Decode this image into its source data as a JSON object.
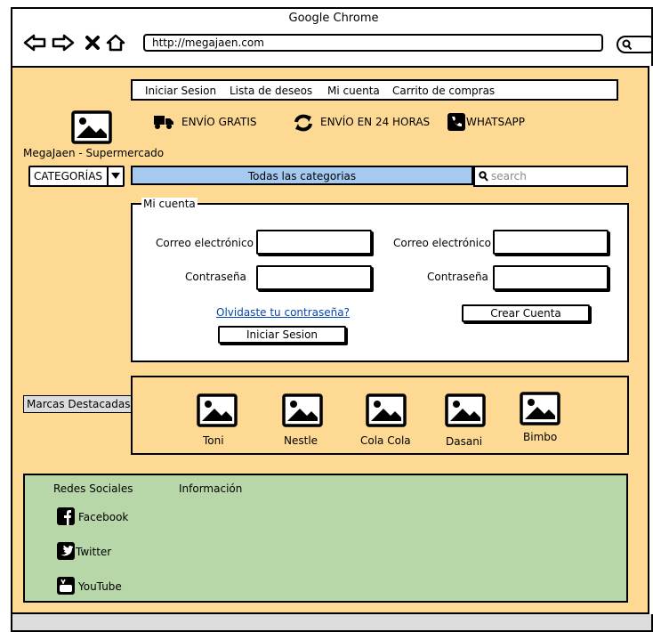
{
  "window": {
    "title": "Google Chrome",
    "url": "http://megajaen.com"
  },
  "nav": {
    "items": [
      "Iniciar Sesion",
      "Lista de deseos",
      "Mi cuenta",
      "Carrito de compras"
    ]
  },
  "features": {
    "free_shipping": "ENVÍO GRATIS",
    "fast_delivery": "ENVÍO EN 24 HORAS",
    "whatsapp": "WHATSAPP"
  },
  "brand": {
    "name": "MegaJaen - Supermercado"
  },
  "search": {
    "category_label": "CATEGORÍAS",
    "all_categories": "Todas las categorias",
    "placeholder": "search"
  },
  "account": {
    "legend": "Mi cuenta",
    "login_email_label": "Correo electrónico",
    "login_password_label": "Contraseña",
    "forgot_link": "Olvidaste tu contraseña?",
    "login_button": "Iniciar Sesion",
    "register_email_label": "Correo electrónico",
    "register_password_label": "Contraseña",
    "create_button": "Crear Cuenta"
  },
  "brands": {
    "label": "Marcas Destacadas",
    "items": [
      "Toni",
      "Nestle",
      "Cola Cola",
      "Dasani",
      "Bimbo"
    ]
  },
  "footer": {
    "social_heading": "Redes Sociales",
    "info_heading": "Información",
    "links": [
      "Facebook",
      "Twitter",
      "YouTube"
    ]
  },
  "colors": {
    "background": "#fdd993",
    "footer": "#b7d7a8",
    "search_bar": "#a6c9f0"
  }
}
